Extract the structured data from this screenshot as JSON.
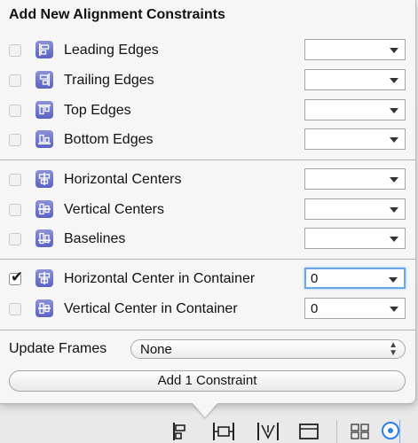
{
  "popover": {
    "title": "Add New Alignment Constraints",
    "rows": [
      {
        "label": "Leading Edges",
        "checked": false,
        "value": "",
        "icon": "leading-edges-icon"
      },
      {
        "label": "Trailing Edges",
        "checked": false,
        "value": "",
        "icon": "trailing-edges-icon"
      },
      {
        "label": "Top Edges",
        "checked": false,
        "value": "",
        "icon": "top-edges-icon"
      },
      {
        "label": "Bottom Edges",
        "checked": false,
        "value": "",
        "icon": "bottom-edges-icon"
      },
      {
        "label": "Horizontal Centers",
        "checked": false,
        "value": "",
        "icon": "horizontal-centers-icon"
      },
      {
        "label": "Vertical Centers",
        "checked": false,
        "value": "",
        "icon": "vertical-centers-icon"
      },
      {
        "label": "Baselines",
        "checked": false,
        "value": "",
        "icon": "baselines-icon"
      },
      {
        "label": "Horizontal Center in Container",
        "checked": true,
        "value": "0",
        "icon": "horizontal-center-container-icon"
      },
      {
        "label": "Vertical Center in Container",
        "checked": false,
        "value": "0",
        "icon": "vertical-center-container-icon"
      }
    ],
    "update_frames": {
      "label": "Update Frames",
      "value": "None"
    },
    "add_button": "Add 1 Constraint"
  },
  "colors": {
    "icon_bg": "#6b72cc",
    "focus_ring": "#6aa6e8",
    "accent": "#2b7fe3"
  },
  "toolbar_icons": [
    "align-icon",
    "pin-icon",
    "resolve-issues-icon",
    "resizing-icon",
    "grid-icon",
    "zoom-indicator-icon"
  ]
}
